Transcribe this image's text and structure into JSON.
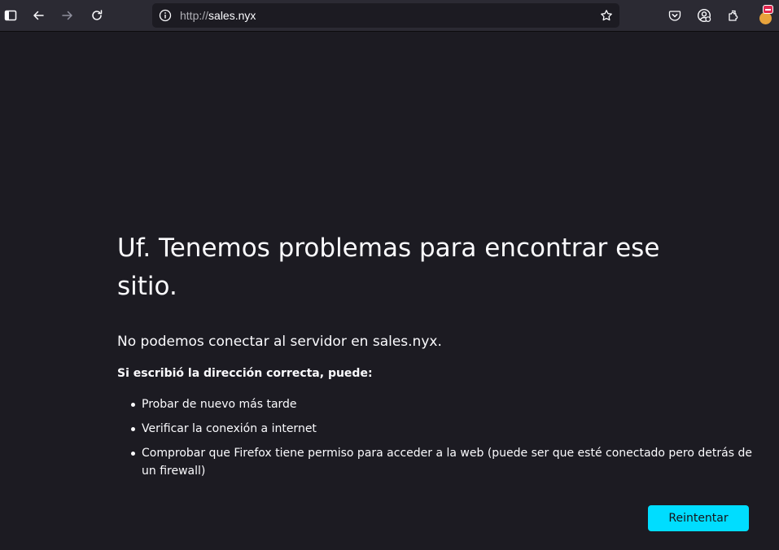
{
  "browser": {
    "url_protocol": "http://",
    "url_host": "sales.nyx",
    "icons": [
      "sidebar-icon",
      "back-icon",
      "forward-icon",
      "reload-icon",
      "info-icon",
      "bookmark-star-icon",
      "pocket-icon",
      "account-icon",
      "extensions-icon",
      "avatar-icon"
    ]
  },
  "error_page": {
    "title": "Uf. Tenemos problemas para encontrar ese sitio.",
    "description": "No podemos conectar al servidor en sales.nyx.",
    "subhead": "Si escribió la dirección correcta, puede:",
    "suggestions": [
      "Probar de nuevo más tarde",
      "Verificar la conexión a internet",
      "Comprobar que Firefox tiene permiso para acceder a la web (puede ser que esté conectado pero detrás de un firewall)"
    ],
    "retry_label": "Reintentar"
  },
  "colors": {
    "page_bg": "#1c1b22",
    "toolbar_bg": "#2b2a33",
    "accent": "#00ddff"
  }
}
